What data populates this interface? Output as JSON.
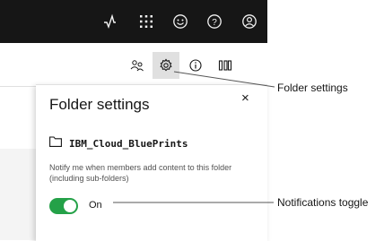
{
  "callouts": {
    "folder_settings": "Folder settings",
    "notifications_toggle": "Notifications toggle"
  },
  "panel": {
    "title": "Folder settings",
    "close_glyph": "×",
    "folder_name": "IBM_Cloud_BluePrints",
    "description": "Notify me when members add content to this folder (including sub-folders)",
    "toggle": {
      "state": "On",
      "on": true,
      "color": "#24a148"
    }
  },
  "topbar_icons": [
    "activity-icon",
    "app-switcher-icon",
    "feedback-smiley-icon",
    "help-icon",
    "user-avatar-icon"
  ],
  "toolbar_icons": [
    "members-icon",
    "settings-icon",
    "info-icon",
    "columns-icon"
  ]
}
